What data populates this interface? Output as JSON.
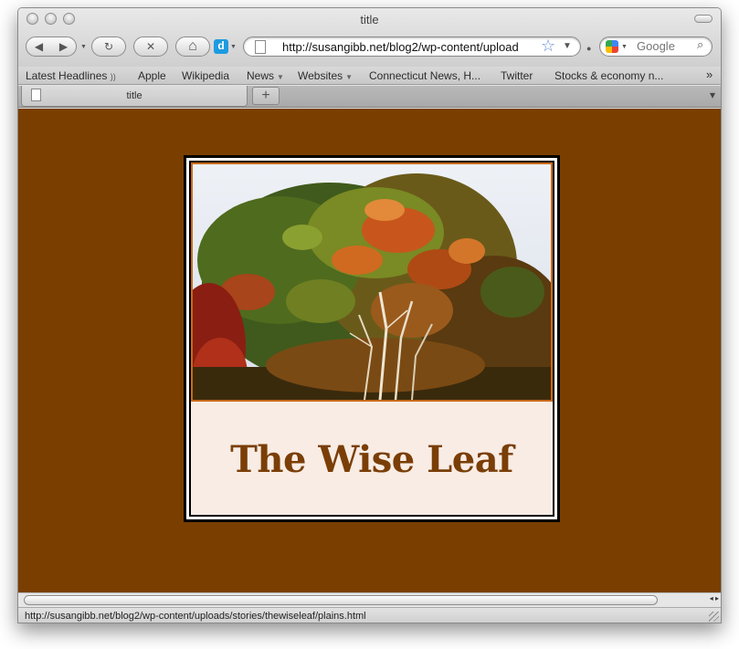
{
  "window": {
    "title": "title"
  },
  "toolbar": {
    "back_glyph": "◀",
    "forward_glyph": "▶",
    "reload_glyph": "↻",
    "stop_glyph": "✕",
    "home_glyph": "⌂",
    "d_glyph": "d",
    "url": "http://susangibb.net/blog2/wp-content/upload",
    "star_glyph": "☆",
    "url_dropdown_glyph": "▼",
    "search_placeholder": "Google",
    "search_glyph": "⌕"
  },
  "bookmarks": {
    "latest_headlines": "Latest Headlines",
    "rss_glyph": "))",
    "apple": "Apple",
    "wikipedia": "Wikipedia",
    "news": "News",
    "websites": "Websites",
    "connecticut": "Connecticut News, H...",
    "twitter": "Twitter",
    "stocks": "Stocks & economy n...",
    "overflow_glyph": "»"
  },
  "tabs": {
    "active_title": "title",
    "new_tab_glyph": "+",
    "overview_glyph": "▾"
  },
  "page": {
    "brand_name": "The Wise Leaf",
    "photo_desc_icon": "autumn-trees-photo"
  },
  "status": {
    "text": "http://susangibb.net/blog2/wp-content/uploads/stories/thewiseleaf/plains.html",
    "scroll_arrows": "◂ ▸"
  },
  "colors": {
    "page_background": "#7a3f00",
    "panel_background": "#f8ece4",
    "brand_text": "#7a3e07",
    "photo_border": "#c96a1b"
  }
}
